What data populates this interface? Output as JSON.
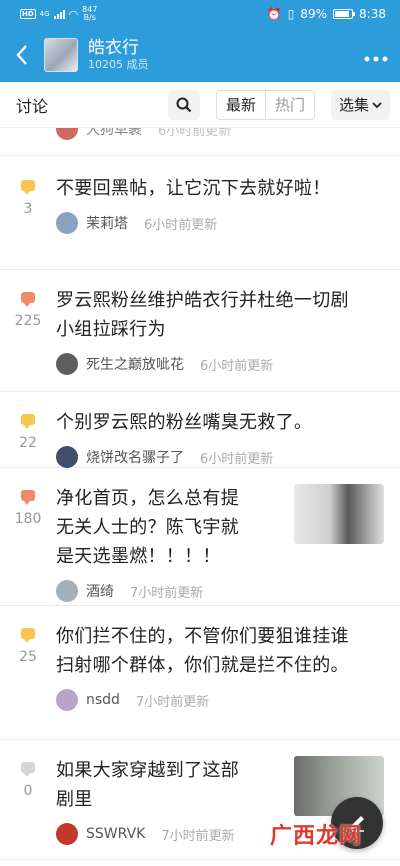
{
  "status_bar": {
    "network": "HD",
    "signal_label": "4G",
    "speed_value": "847",
    "speed_unit": "B/s",
    "battery": "89%",
    "time": "8:38"
  },
  "header": {
    "title": "皓衣行",
    "members": "10205 成员"
  },
  "tabs": {
    "discuss": "讨论",
    "latest": "最新",
    "hot": "热门",
    "collection": "选集"
  },
  "partial_post": {
    "author": "大狗草裹",
    "time": "6小时前更新"
  },
  "posts": [
    {
      "title_lines": [
        "不要回黑帖，让它沉下去就好啦！"
      ],
      "count": "3",
      "bubble": "yellow",
      "author": "茉莉塔",
      "time": "6小时前更新",
      "has_thumb": false
    },
    {
      "title_lines": [
        "罗云熙粉丝维护皓衣行并杜绝一切剧",
        "小组拉踩行为"
      ],
      "count": "225",
      "bubble": "red",
      "author": "死生之巅放呲花",
      "time": "6小时前更新",
      "has_thumb": false
    },
    {
      "title_lines": [
        "个别罗云熙的粉丝嘴臭无救了。"
      ],
      "count": "22",
      "bubble": "yellow",
      "author": "烧饼改名骡子了",
      "time": "6小时前更新",
      "has_thumb": false
    },
    {
      "title_lines": [
        "净化首页，怎么总有提",
        "无关人士的？陈飞宇就",
        "是天选墨燃！！！！"
      ],
      "count": "180",
      "bubble": "red",
      "author": "酒绮",
      "time": "7小时前更新",
      "has_thumb": true
    },
    {
      "title_lines": [
        "你们拦不住的，不管你们要狙谁挂谁",
        "扫射哪个群体，你们就是拦不住的。"
      ],
      "count": "25",
      "bubble": "yellow",
      "author": "nsdd",
      "time": "7小时前更新",
      "has_thumb": false
    },
    {
      "title_lines": [
        "如果大家穿越到了这部",
        "剧里"
      ],
      "count": "0",
      "bubble": "gray",
      "author": "SSWRVK",
      "time": "7小时前更新",
      "has_thumb": true
    }
  ],
  "watermark": "广西龙网",
  "icons": {
    "back": "chevron-left-icon",
    "more": "more-dots-icon",
    "search": "search-icon",
    "dropdown": "chevron-down-icon",
    "compose": "pencil-icon"
  },
  "colors": {
    "header_blue": "#2d9cdb",
    "yellow": "#f5c84c",
    "red": "#f08a6c"
  }
}
